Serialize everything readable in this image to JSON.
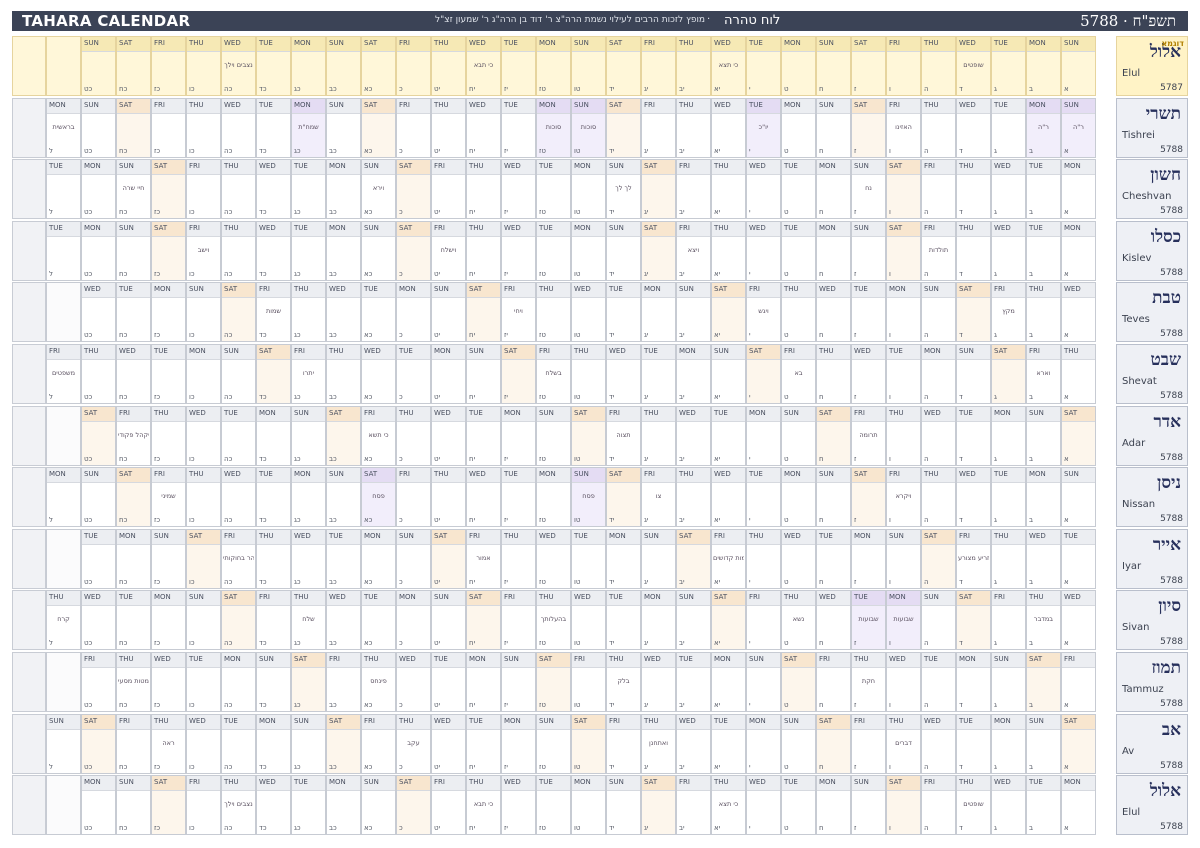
{
  "header": {
    "title": "TAHARA CALENDAR",
    "subtitle": "מופץ לזכות הרבים לעילוי נשמת הרה\"צ ר' דוד בן הרה\"ג ר' שמעון זצ\"ל",
    "name": "לוח טהרה",
    "year": "5788 · תשפ\"ח"
  },
  "months": [
    {
      "heb": "אלול",
      "eng": "Elul",
      "year": "5787",
      "example": true,
      "example_label": "דוגמא",
      "start": 0,
      "days": 29
    },
    {
      "heb": "תשרי",
      "eng": "Tishrei",
      "year": "5788",
      "example": false,
      "start": 0,
      "days": 30
    },
    {
      "heb": "חשון",
      "eng": "Cheshvan",
      "year": "5788",
      "example": false,
      "start": 1,
      "days": 30
    },
    {
      "heb": "כסלו",
      "eng": "Kislev",
      "year": "5788",
      "example": false,
      "start": 1,
      "days": 30
    },
    {
      "heb": "טבת",
      "eng": "Teves",
      "year": "5788",
      "example": false,
      "start": 3,
      "days": 29
    },
    {
      "heb": "שבט",
      "eng": "Shevat",
      "year": "5788",
      "example": false,
      "start": 4,
      "days": 30
    },
    {
      "heb": "אדר",
      "eng": "Adar",
      "year": "5788",
      "example": false,
      "start": 6,
      "days": 29
    },
    {
      "heb": "ניסן",
      "eng": "Nissan",
      "year": "5788",
      "example": false,
      "start": 0,
      "days": 30
    },
    {
      "heb": "אייר",
      "eng": "Iyar",
      "year": "5788",
      "example": false,
      "start": 2,
      "days": 29
    },
    {
      "heb": "סיון",
      "eng": "Sivan",
      "year": "5788",
      "example": false,
      "start": 3,
      "days": 30
    },
    {
      "heb": "תמוז",
      "eng": "Tammuz",
      "year": "5788",
      "example": false,
      "start": 5,
      "days": 29
    },
    {
      "heb": "אב",
      "eng": "Av",
      "year": "5788",
      "example": false,
      "start": 6,
      "days": 30
    },
    {
      "heb": "אלול",
      "eng": "Elul",
      "year": "5788",
      "example": false,
      "start": 1,
      "days": 29
    }
  ],
  "hebrew_numerals": [
    "א",
    "ב",
    "ג",
    "ד",
    "ה",
    "ו",
    "ז",
    "ח",
    "ט",
    "י",
    "יא",
    "יב",
    "יג",
    "יד",
    "טו",
    "טז",
    "יז",
    "יח",
    "יט",
    "כ",
    "כא",
    "כב",
    "כג",
    "כד",
    "כה",
    "כו",
    "כז",
    "כח",
    "כט",
    "ל"
  ],
  "weekdays": [
    "SUN",
    "MON",
    "TUE",
    "WED",
    "THU",
    "FRI",
    "SAT"
  ],
  "parshiyos": {
    "1": {
      "1": "ר\"ה",
      "2": "ר\"ה",
      "6": "האזינו",
      "10": "יו\"כ",
      "15": "סוכות",
      "16": "סוכות",
      "23": "שמח\"ת",
      "30": "בראשית"
    },
    "2": {
      "7": "נח",
      "14": "לך לך",
      "21": "וירא",
      "28": "חיי שרה"
    },
    "3": {
      "5": "תולדות",
      "12": "ויצא",
      "19": "וישלח",
      "26": "וישב"
    },
    "4": {
      "3": "מקץ",
      "10": "ויגש",
      "17": "ויחי",
      "24": "שמות"
    },
    "5": {
      "2": "וארא",
      "9": "בא",
      "16": "בשלח",
      "23": "יתרו",
      "30": "משפטים"
    },
    "6": {
      "7": "תרומה",
      "14": "תצוה",
      "21": "כי תשא",
      "28": "ויקהל פקודי"
    },
    "7": {
      "6": "ויקרא",
      "13": "צו",
      "15": "פסח",
      "21": "פסח",
      "27": "שמיני"
    },
    "8": {
      "4": "תזריע מצורע",
      "11": "אחרי מות קדושים",
      "18": "אמור",
      "25": "בהר בחוקותי"
    },
    "9": {
      "2": "במדבר",
      "6": "שבועות",
      "7": "שבועות",
      "9": "נשא",
      "16": "בהעלותך",
      "23": "שלח",
      "30": "קרח"
    },
    "10": {
      "7": "חקת",
      "14": "בלק",
      "21": "פינחס",
      "28": "מטות מסעי"
    },
    "11": {
      "6": "דברים",
      "13": "ואתחנן",
      "20": "עקב",
      "27": "ראה"
    },
    "12": {
      "4": "שופטים",
      "11": "כי תצא",
      "18": "כי תבא",
      "25": "נצבים וילך"
    },
    "0": {
      "4": "שופטים",
      "11": "כי תצא",
      "18": "כי תבא",
      "25": "נצבים וילך"
    }
  }
}
